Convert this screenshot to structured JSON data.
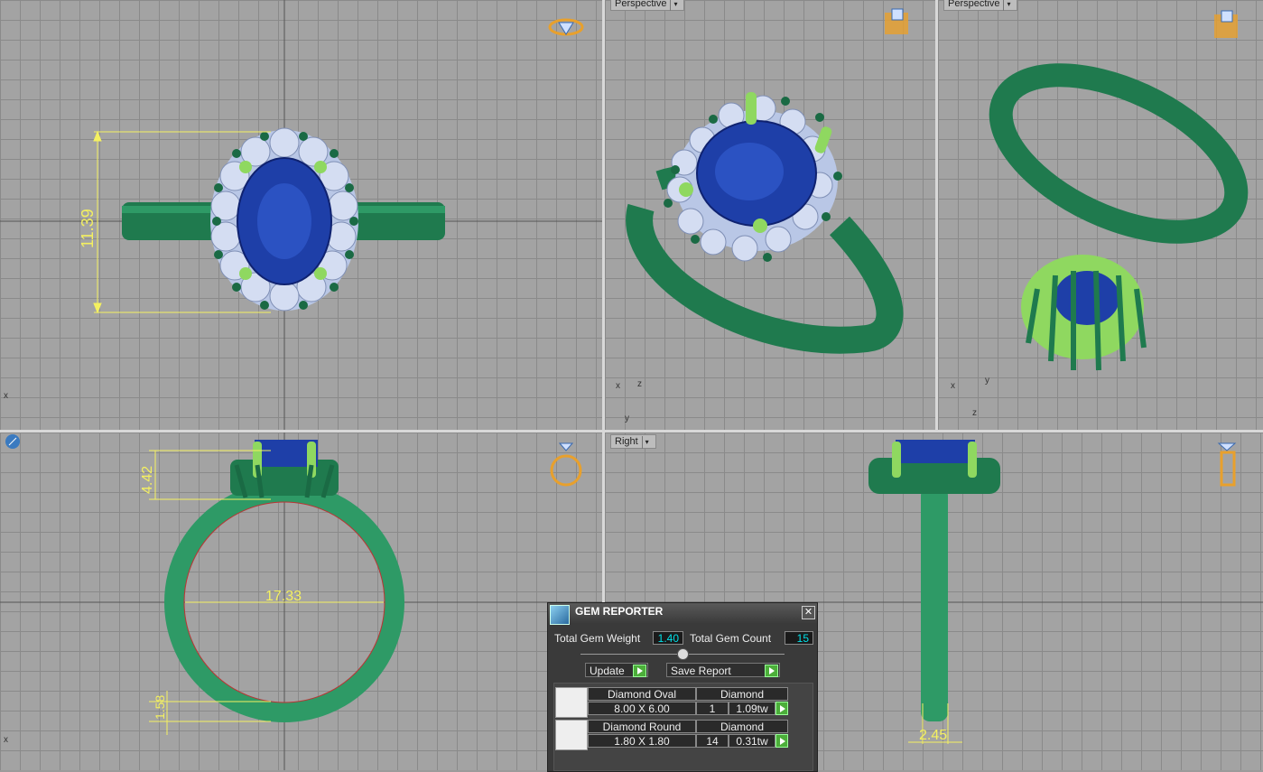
{
  "viewports": {
    "top": {
      "label": "",
      "dimension": "11.39"
    },
    "perspective1": {
      "label": "Perspective"
    },
    "perspective2": {
      "label": "Perspective"
    },
    "front": {
      "label": "",
      "dim_height": "4.42",
      "dim_inner": "17.33",
      "dim_thick": "1.58"
    },
    "right": {
      "label": "Right",
      "dim_width": "2.45"
    }
  },
  "gem_reporter": {
    "title": "GEM REPORTER",
    "total_weight_label": "Total Gem Weight",
    "total_weight_value": "1.40",
    "total_count_label": "Total Gem Count",
    "total_count_value": "15",
    "update_label": "Update",
    "save_label": "Save Report",
    "rows": [
      {
        "shape": "Diamond Oval",
        "material": "Diamond",
        "size": "8.00 X 6.00",
        "count": "1",
        "weight": "1.09tw"
      },
      {
        "shape": "Diamond Round",
        "material": "Diamond",
        "size": "1.80 X 1.80",
        "count": "14",
        "weight": "0.31tw"
      }
    ]
  },
  "colors": {
    "metal": "#1f7a4e",
    "sapphire": "#1e3fa8",
    "diamond": "#c9d6ee",
    "prong": "#8fd860",
    "dim": "#f4f060"
  }
}
